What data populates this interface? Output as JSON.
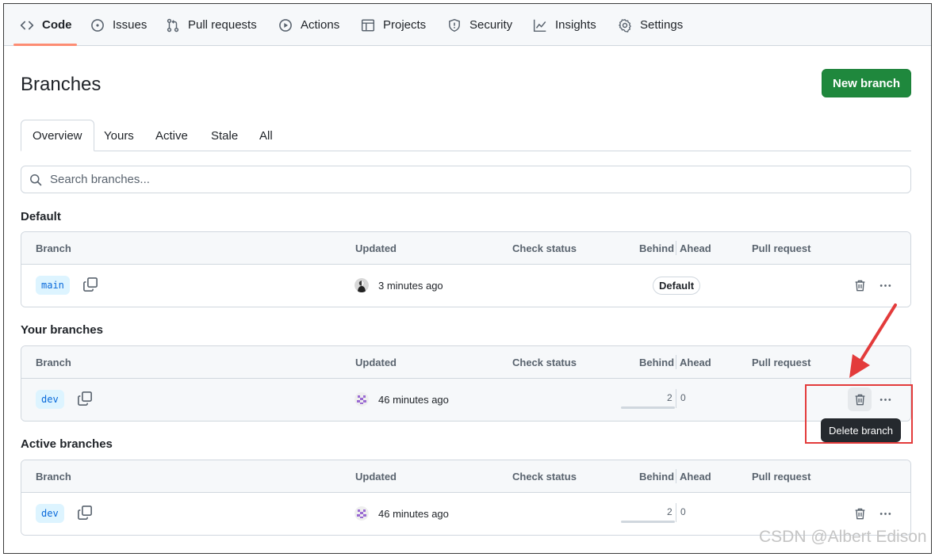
{
  "nav": {
    "items": [
      {
        "label": "Code",
        "icon": "code-icon",
        "active": true
      },
      {
        "label": "Issues",
        "icon": "issue-icon"
      },
      {
        "label": "Pull requests",
        "icon": "pull-request-icon"
      },
      {
        "label": "Actions",
        "icon": "play-icon"
      },
      {
        "label": "Projects",
        "icon": "table-icon"
      },
      {
        "label": "Security",
        "icon": "shield-icon"
      },
      {
        "label": "Insights",
        "icon": "graph-icon"
      },
      {
        "label": "Settings",
        "icon": "gear-icon"
      }
    ],
    "accent_color": "#fd8c73"
  },
  "header": {
    "title": "Branches",
    "new_branch_label": "New branch",
    "button_color": "#1f883d"
  },
  "tabs": [
    "Overview",
    "Yours",
    "Active",
    "Stale",
    "All"
  ],
  "search": {
    "placeholder": "Search branches..."
  },
  "columns": {
    "branch": "Branch",
    "updated": "Updated",
    "check_status": "Check status",
    "behind": "Behind",
    "ahead": "Ahead",
    "pull_request": "Pull request"
  },
  "sections": {
    "default": {
      "title": "Default",
      "row": {
        "name": "main",
        "updated": "3 minutes ago",
        "badge": "Default"
      }
    },
    "yours": {
      "title": "Your branches",
      "row": {
        "name": "dev",
        "updated": "46 minutes ago",
        "behind": "2",
        "ahead": "0"
      }
    },
    "active": {
      "title": "Active branches",
      "row": {
        "name": "dev",
        "updated": "46 minutes ago",
        "behind": "2",
        "ahead": "0"
      }
    }
  },
  "tooltip": {
    "text": "Delete branch"
  },
  "annotation": {
    "highlight_color": "#e33b3b"
  },
  "watermark": "CSDN @Albert Edison"
}
